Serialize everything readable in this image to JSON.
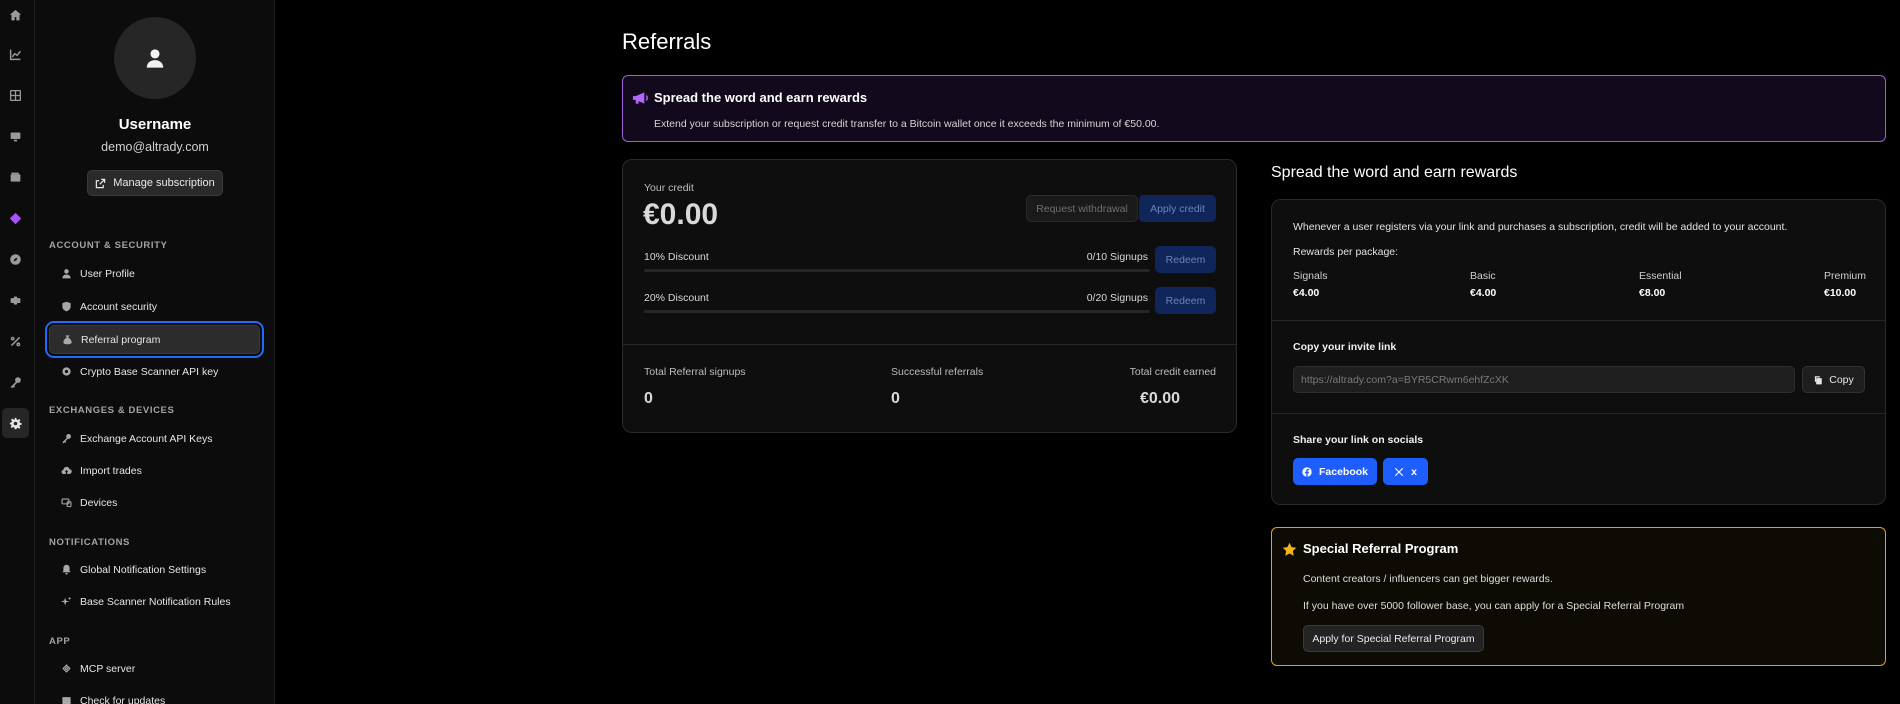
{
  "user": {
    "name": "Username",
    "email": "demo@altrady.com",
    "manage_label": "Manage subscription"
  },
  "sidebar": {
    "sections": [
      {
        "title": "ACCOUNT & SECURITY",
        "items": [
          {
            "label": "User Profile",
            "icon": "user-icon"
          },
          {
            "label": "Account security",
            "icon": "shield-icon"
          },
          {
            "label": "Referral program",
            "icon": "money-bag-icon",
            "active": true
          },
          {
            "label": "Crypto Base Scanner API key",
            "icon": "gear-icon"
          }
        ]
      },
      {
        "title": "EXCHANGES & DEVICES",
        "items": [
          {
            "label": "Exchange Account API Keys",
            "icon": "key-icon"
          },
          {
            "label": "Import trades",
            "icon": "cloud-upload-icon"
          },
          {
            "label": "Devices",
            "icon": "devices-icon"
          }
        ]
      },
      {
        "title": "NOTIFICATIONS",
        "items": [
          {
            "label": "Global Notification Settings",
            "icon": "bell-icon"
          },
          {
            "label": "Base Scanner Notification Rules",
            "icon": "sparkle-icon"
          }
        ]
      },
      {
        "title": "APP",
        "items": [
          {
            "label": "MCP server",
            "icon": "mcp-icon"
          },
          {
            "label": "Check for updates",
            "icon": "update-icon"
          }
        ]
      }
    ]
  },
  "main": {
    "title": "Referrals",
    "banner": {
      "title": "Spread the word and earn rewards",
      "text": "Extend your subscription or request credit transfer to a Bitcoin wallet once it exceeds the minimum of €50.00."
    },
    "credit": {
      "label": "Your credit",
      "value": "€0.00",
      "request_withdrawal": "Request withdrawal",
      "apply_credit": "Apply credit",
      "discounts": [
        {
          "name": "10% Discount",
          "count": "0/10 Signups",
          "progress": 0,
          "redeem": "Redeem"
        },
        {
          "name": "20% Discount",
          "count": "0/20 Signups",
          "progress": 0,
          "redeem": "Redeem"
        }
      ],
      "stats": [
        {
          "label": "Total Referral signups",
          "value": "0"
        },
        {
          "label": "Successful referrals",
          "value": "0"
        },
        {
          "label": "Total credit earned",
          "value": "€0.00"
        }
      ]
    },
    "rewards": {
      "title": "Spread the word and earn rewards",
      "intro": "Whenever a user registers via your link and purchases a subscription, credit will be added to your account.",
      "per_package": "Rewards per package:",
      "packages": [
        {
          "name": "Signals",
          "value": "€4.00"
        },
        {
          "name": "Basic",
          "value": "€4.00"
        },
        {
          "name": "Essential",
          "value": "€8.00"
        },
        {
          "name": "Premium",
          "value": "€10.00"
        }
      ],
      "invite_heading": "Copy your invite link",
      "invite_link": "https://altrady.com?a=BYR5CRwm6ehfZcXK",
      "copy_label": "Copy",
      "share_heading": "Share your link on socials",
      "facebook_label": "Facebook",
      "x_label": "x"
    },
    "special": {
      "title": "Special Referral Program",
      "line1": "Content creators / influencers can get bigger rewards.",
      "line2": "If you have over 5000 follower base, you can apply for a Special Referral Program",
      "button": "Apply for Special Referral Program"
    }
  },
  "colors": {
    "accent": "#1e5eff",
    "banner_border": "#9a5fd8",
    "special_border": "#e0a415",
    "active_outline": "#1e6bff"
  }
}
